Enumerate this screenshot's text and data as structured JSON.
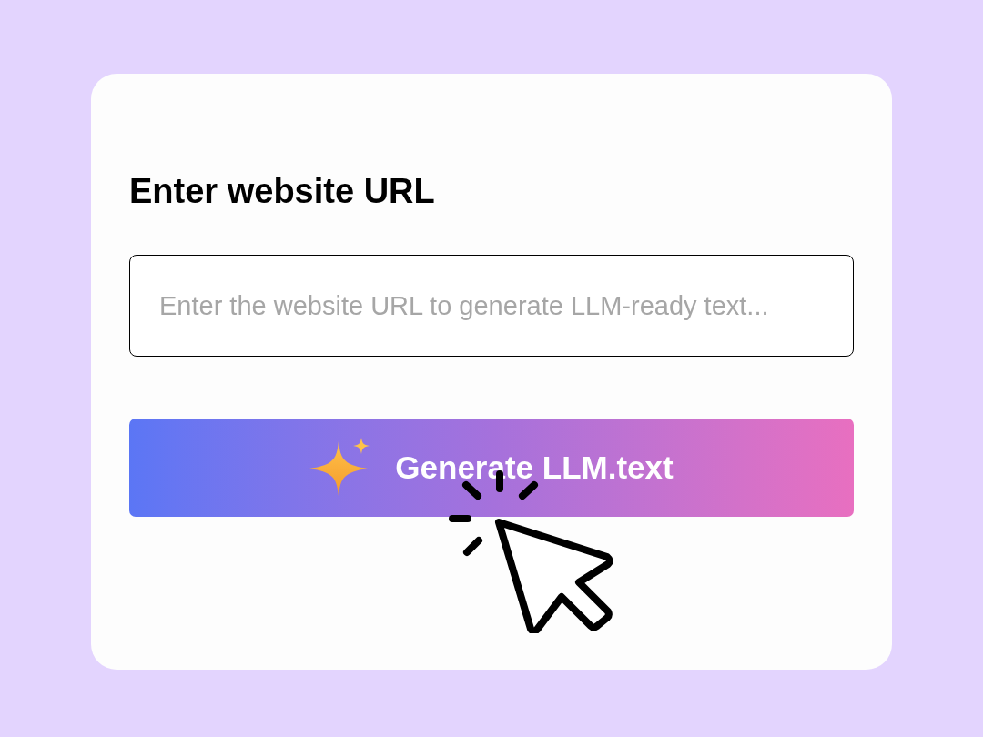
{
  "heading": "Enter website URL",
  "url_input": {
    "placeholder": "Enter the website URL to generate LLM-ready text..."
  },
  "generate_button": {
    "label": "Generate LLM.text"
  }
}
